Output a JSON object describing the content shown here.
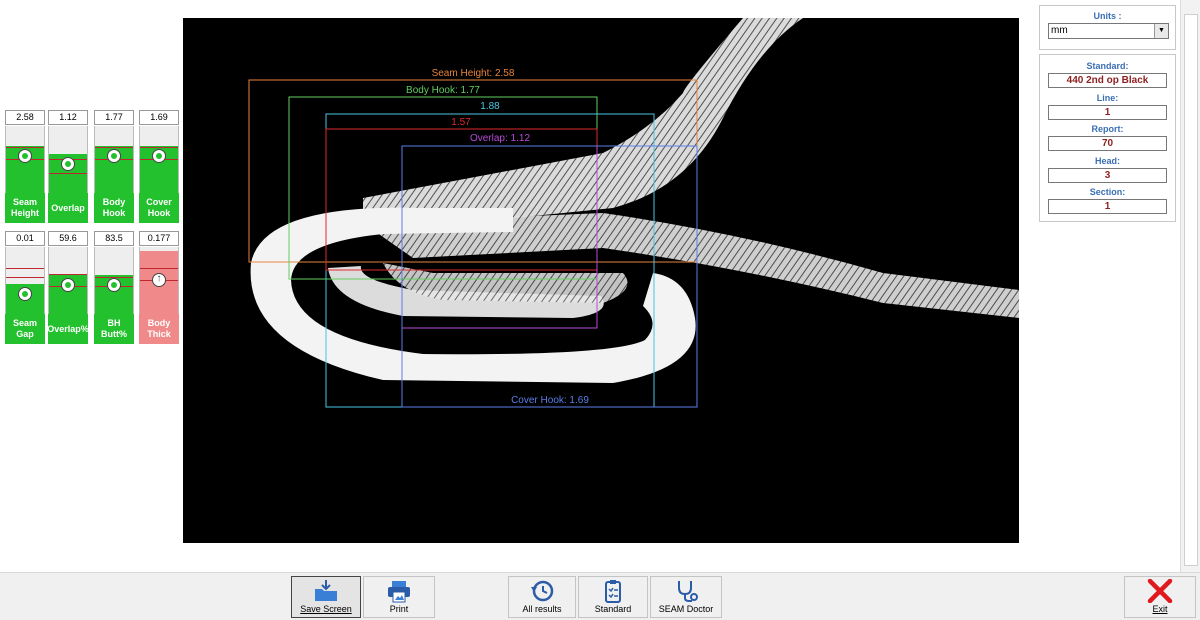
{
  "gauges": [
    {
      "value": "2.58",
      "label": "Seam Height",
      "level": 0.7,
      "band_top": 0.31,
      "band_mid": 0.49,
      "status": "ok",
      "fill_color": "#23c12e",
      "label_bg": "#23c12e"
    },
    {
      "value": "1.12",
      "label": "Overlap",
      "level": 0.58,
      "band_top": 0.49,
      "band_mid": 0.7,
      "status": "ok",
      "fill_color": "#23c12e",
      "label_bg": "#23c12e"
    },
    {
      "value": "1.77",
      "label": "Body Hook",
      "level": 0.7,
      "band_top": 0.31,
      "band_mid": 0.49,
      "status": "ok",
      "fill_color": "#23c12e",
      "label_bg": "#23c12e"
    },
    {
      "value": "1.69",
      "label": "Cover Hook",
      "level": 0.7,
      "band_top": 0.31,
      "band_mid": 0.49,
      "status": "ok",
      "fill_color": "#23c12e",
      "label_bg": "#23c12e"
    },
    {
      "value": "0.01",
      "label": "Seam Gap",
      "level": 0.45,
      "band_top": 0.31,
      "band_mid": 0.45,
      "status": "ok",
      "fill_color": "#23c12e",
      "label_bg": "#23c12e"
    },
    {
      "value": "59.6",
      "label": "Overlap%",
      "level": 0.58,
      "band_top": 0.4,
      "band_mid": 0.58,
      "status": "ok",
      "fill_color": "#23c12e",
      "label_bg": "#23c12e"
    },
    {
      "value": "83.5",
      "label": "BH Butt%",
      "level": 0.58,
      "band_top": 0.45,
      "band_mid": 0.58,
      "status": "ok",
      "fill_color": "#23c12e",
      "label_bg": "#23c12e"
    },
    {
      "value": "0.177",
      "label": "Body Thick",
      "level": 0.94,
      "band_top": 0.31,
      "band_mid": 0.49,
      "status": "high",
      "fill_color": "#f08a8a",
      "label_bg": "#f08a8a"
    }
  ],
  "overlays": {
    "seam_height": {
      "text": "Seam Height: 2.58",
      "color": "#e8843c"
    },
    "body_hook": {
      "text": "Body Hook: 1.77",
      "color": "#5fcf5f"
    },
    "unnamed_blue": {
      "text": "1.88",
      "color": "#4ac6e6"
    },
    "unnamed_red": {
      "text": "1.57",
      "color": "#e02a2a"
    },
    "overlap": {
      "text": "Overlap: 1.12",
      "color": "#b84ad8"
    },
    "cover_hook": {
      "text": "Cover Hook: 1.69",
      "color": "#5a7ee8"
    }
  },
  "panel": {
    "units_label": "Units :",
    "units_value": "mm",
    "standard_label": "Standard:",
    "standard_value": "440 2nd op Black",
    "line_label": "Line:",
    "line_value": "1",
    "report_label": "Report:",
    "report_value": "70",
    "head_label": "Head:",
    "head_value": "3",
    "section_label": "Section:",
    "section_value": "1"
  },
  "toolbar": {
    "save_label": "Save Screen",
    "print_label": "Print",
    "all_results_label": "All results",
    "standard_label": "Standard",
    "seam_doctor_label": "SEAM Doctor",
    "exit_label": "Exit"
  },
  "icons": {
    "save": "save-folder-icon",
    "print": "printer-icon",
    "history": "history-clock-icon",
    "standard": "clipboard-checklist-icon",
    "doctor": "stethoscope-icon",
    "exit": "red-x-icon"
  }
}
